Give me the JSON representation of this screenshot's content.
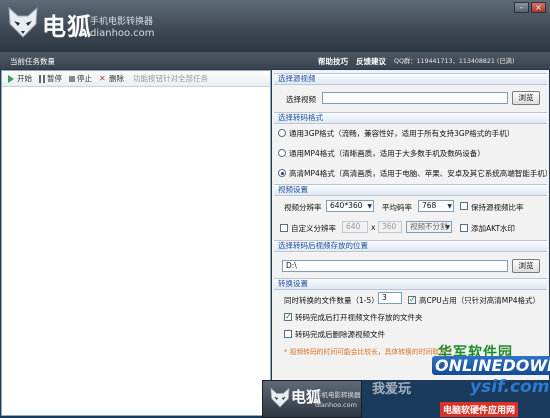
{
  "app": {
    "title_cn": "电狐",
    "subtitle": "手机电影转换器",
    "url": "dianhoo.com",
    "window_buttons": [
      "-",
      "×"
    ]
  },
  "infobar": {
    "current_task": "当前任务数量",
    "help": "帮助技巧",
    "feedback": "反馈建议",
    "qq": "QQ群：119441713、113408821 (已满)"
  },
  "toolbar": {
    "start": "开始",
    "pause": "暂停",
    "stop": "停止",
    "delete": "删除",
    "hint": "功能按钮针对全部任务"
  },
  "source": {
    "section": "选择源视频",
    "label": "选择视频",
    "value": "",
    "browse": "浏览"
  },
  "format": {
    "section": "选择转码格式",
    "options": [
      {
        "label": "通用3GP格式（流畅，兼容性好，适用于所有支持3GP格式的手机）",
        "selected": false
      },
      {
        "label": "通用MP4格式（清晰画质，适用于大多数手机及数码设备）",
        "selected": false
      },
      {
        "label": "高清MP4格式（高清画质，适用于电脑、苹果、安卓及其它系统高端智能手机）",
        "selected": true
      }
    ]
  },
  "video": {
    "section": "视频设置",
    "resolution_label": "视频分辨率",
    "resolution_value": "640*360",
    "bitrate_label": "平均码率",
    "bitrate_value": "768",
    "keep_ratio_label": "保持源视频比率",
    "keep_ratio_checked": false,
    "custom_res_label": "自定义分辨率",
    "custom_res_checked": false,
    "custom_w": "640",
    "custom_x": "x",
    "custom_h": "360",
    "split_value": "视频不分割",
    "watermark_label": "添加AKT水印",
    "watermark_checked": false
  },
  "output": {
    "section": "选择转码后视频存放的位置",
    "path": "D:\\",
    "browse": "浏览"
  },
  "convert": {
    "section": "转换设置",
    "simul_label": "同时转换的文件数量（1-5）",
    "simul_value": "3",
    "cpu_label": "高CPU占用（只针对高清MP4格式）",
    "cpu_checked": true,
    "open_folder_label": "转码完成后打开视频文件存放的文件夹",
    "open_folder_checked": true,
    "delete_src_label": "转码完成后删除源视频文件",
    "delete_src_checked": false
  },
  "note": "* 视频转码的时间可能会比较长，具体转换的时间取决于",
  "watermark": {
    "site_cn": "华军软件园",
    "site_en": "ONLINEDOWN",
    "site_num": "ysif.com",
    "bottom_cn": "电脑软硬件应用网",
    "mid": "我爱玩"
  }
}
